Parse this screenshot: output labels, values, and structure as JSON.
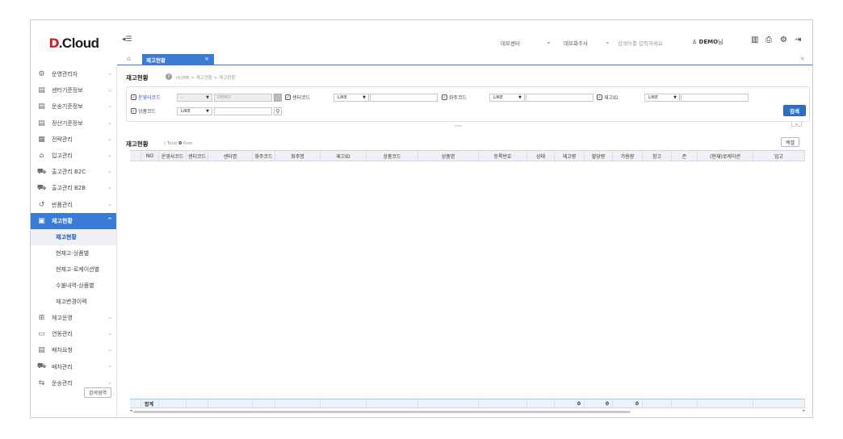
{
  "brand": {
    "mark": "D",
    "text": ".Cloud"
  },
  "topbar": {
    "center_select": "데모센터",
    "owner_select": "데모화주사",
    "search_placeholder": "검색어를 입력하세요",
    "user_name": "DEMO",
    "user_suffix": "님"
  },
  "tabs": [
    {
      "label": "재고현황",
      "close": "×"
    }
  ],
  "close_all": "×",
  "sidebar": {
    "items": [
      {
        "label": "운영관리자",
        "icon": "user-gear-icon"
      },
      {
        "label": "센터기준정보",
        "icon": "document-icon"
      },
      {
        "label": "운송기준정보",
        "icon": "document-icon"
      },
      {
        "label": "정산기준정보",
        "icon": "document-icon"
      },
      {
        "label": "전략관리",
        "icon": "chart-icon"
      },
      {
        "label": "입고관리",
        "icon": "warehouse-icon"
      },
      {
        "label": "출고관리 B2C",
        "icon": "truck-icon"
      },
      {
        "label": "출고관리 B2B",
        "icon": "truck-icon"
      },
      {
        "label": "반품관리",
        "icon": "return-icon"
      },
      {
        "label": "재고현황",
        "icon": "box-icon",
        "active": true
      },
      {
        "label": "재고운영",
        "icon": "grid-icon"
      },
      {
        "label": "연동관리",
        "icon": "monitor-icon"
      },
      {
        "label": "배차요청",
        "icon": "document-icon"
      },
      {
        "label": "배차관리",
        "icon": "truck-icon"
      },
      {
        "label": "운송관리",
        "icon": "route-icon"
      }
    ],
    "sub_items": [
      {
        "label": "재고현황",
        "current": true
      },
      {
        "label": "현재고-상품별"
      },
      {
        "label": "현재고-로케이션별"
      },
      {
        "label": "수불내역-상품별"
      },
      {
        "label": "재고변경이력"
      }
    ],
    "search_area_button": "검색영역"
  },
  "page": {
    "title": "재고현황",
    "breadcrumb": "HOME > 재고현황 > 재고현황"
  },
  "filters": {
    "owner_company_code_label": "운영사코드",
    "owner_company_select": "-",
    "owner_company_value": "DEMO",
    "center_code_label": "센터코드",
    "center_code_op": "LIKE",
    "client_code_label": "화주코드",
    "client_code_op": "LIKE",
    "stock_id_label": "재고ID",
    "stock_id_op": "LIKE",
    "product_code_label": "상품코드",
    "product_code_op": "LIKE",
    "search_button": "검색"
  },
  "grid": {
    "title": "재고현황",
    "total_label": "Total",
    "total_count": "0",
    "total_unit": "Row",
    "excel_button": "엑셀",
    "columns": [
      "NO",
      "운영사코드",
      "센터코드",
      "센터명",
      "화주코드",
      "화주명",
      "재고ID",
      "상품코드",
      "상품명",
      "등록번호",
      "상태",
      "재고량",
      "할당량",
      "가용량",
      "창고",
      "존",
      "(현재)로케이션",
      "입고"
    ],
    "sum_label": "합계",
    "sum_values": [
      "0",
      "0",
      "0"
    ]
  }
}
